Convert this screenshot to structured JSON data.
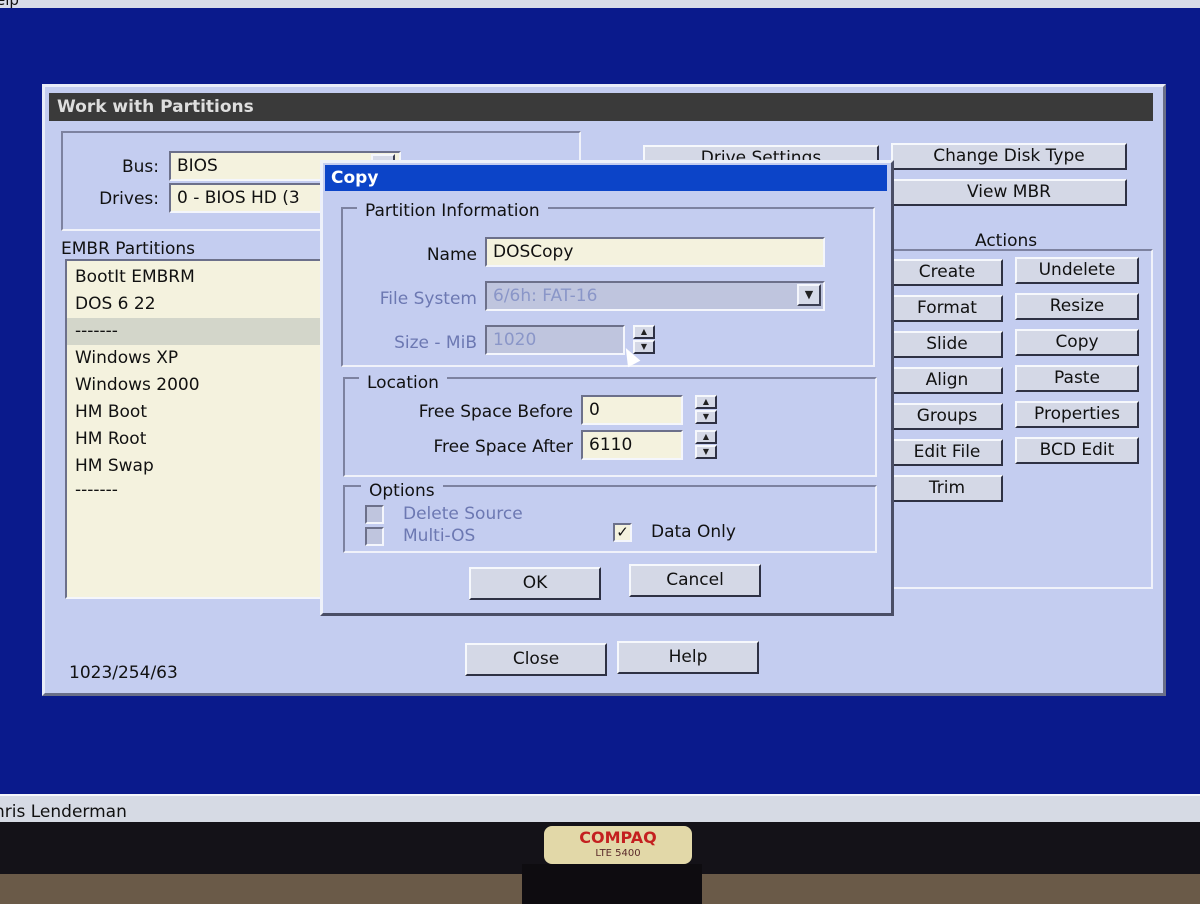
{
  "menu": {
    "partial_label": "elp"
  },
  "status": {
    "text": "hris Lenderman"
  },
  "main_window": {
    "title": "Work with Partitions",
    "bus_label": "Bus:",
    "bus_value": "BIOS",
    "drives_label": "Drives:",
    "drives_value": "0 - BIOS HD (3",
    "drive_settings_label": "Drive Settings",
    "change_disk_type_label": "Change Disk Type",
    "view_mbr_label": "View MBR",
    "partitions_header": "EMBR Partitions",
    "partitions": [
      "BootIt EMBRM",
      "DOS 6 22",
      "-------",
      "Windows XP",
      "Windows 2000",
      "HM Boot",
      "HM Root",
      "HM Swap",
      "-------"
    ],
    "actions_header": "Actions",
    "actions_left": [
      "Create",
      "Format",
      "Slide",
      "Align",
      "Groups",
      "Edit File",
      "Trim"
    ],
    "actions_right": [
      "Undelete",
      "Resize",
      "Copy",
      "Paste",
      "Properties",
      "BCD Edit"
    ],
    "geometry": "1023/254/63",
    "close_label": "Close",
    "help_label": "Help"
  },
  "dialog": {
    "title": "Copy",
    "partition_info_label": "Partition Information",
    "name_label": "Name",
    "name_value": "DOSCopy",
    "file_system_label": "File System",
    "file_system_value": "6/6h: FAT-16",
    "size_label": "Size - MiB",
    "size_value": "1020",
    "location_label": "Location",
    "free_before_label": "Free Space Before",
    "free_before_value": "0",
    "free_after_label": "Free Space After",
    "free_after_value": "6110",
    "options_label": "Options",
    "delete_source_label": "Delete Source",
    "delete_source_checked": false,
    "multi_os_label": "Multi-OS",
    "multi_os_checked": false,
    "data_only_label": "Data Only",
    "data_only_checked": true,
    "ok_label": "OK",
    "cancel_label": "Cancel"
  },
  "monitor": {
    "brand": "COMPAQ",
    "model": "LTE 5400"
  },
  "colors": {
    "desktop": "#0a1a8c",
    "window": "#c4cdf0",
    "dialog_title": "#0c44c8",
    "field": "#f4f2de"
  }
}
